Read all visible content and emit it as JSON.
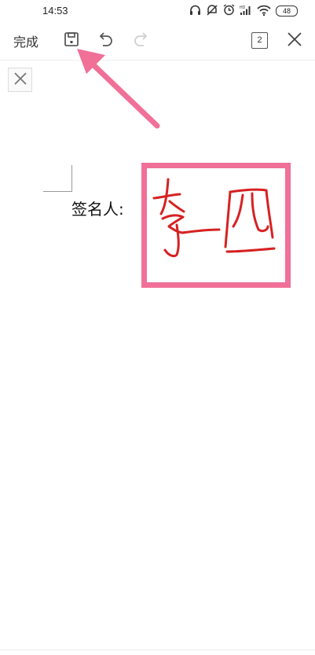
{
  "status_bar": {
    "time": "14:53",
    "battery": "48",
    "icons": [
      "headphones-icon",
      "mute-icon",
      "alarm-icon",
      "hd-signal-icon",
      "wifi-icon",
      "battery-icon"
    ]
  },
  "toolbar": {
    "done_label": "完成",
    "page_count": "2",
    "icons": [
      "save-icon",
      "undo-icon",
      "redo-icon",
      "page-count-icon",
      "close-icon"
    ]
  },
  "document": {
    "signer_label": "签名人:",
    "signature_ink_color": "#d62222",
    "highlight_color": "#f07098"
  }
}
